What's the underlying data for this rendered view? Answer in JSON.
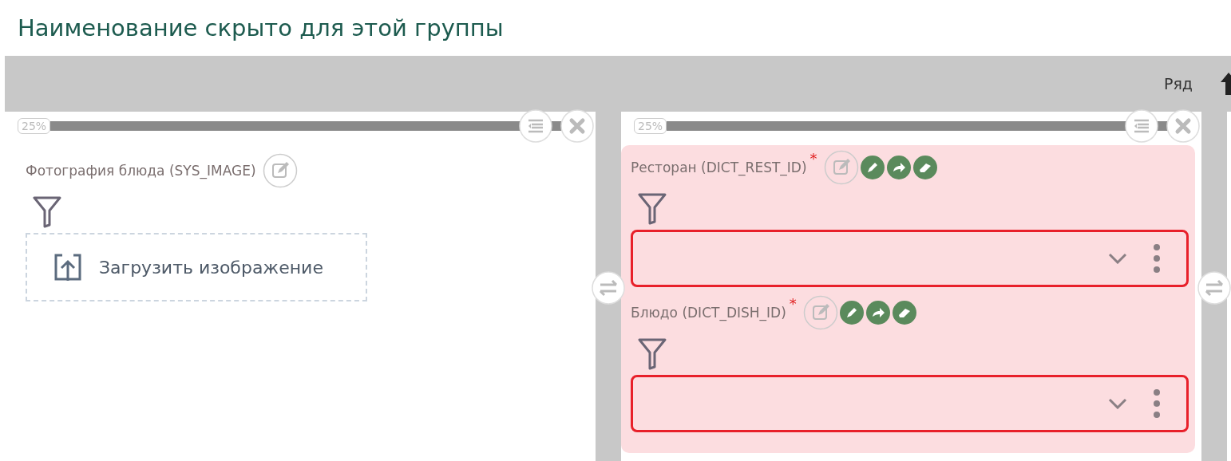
{
  "title": "Наименование скрыто для этой группы",
  "row_bar": {
    "label": "Ряд"
  },
  "columns": [
    {
      "width_label": "25%",
      "fields": [
        {
          "kind": "image",
          "label": "Фотография блюда (SYS_IMAGE)",
          "invalid": false,
          "upload_label": "Загрузить изображение"
        }
      ]
    },
    {
      "width_label": "25%",
      "fields": [
        {
          "kind": "select",
          "label": "Ресторан (DICT_REST_ID)",
          "required_mark": "*",
          "invalid": true
        },
        {
          "kind": "select",
          "label": "Блюдо (DICT_DISH_ID)",
          "required_mark": "*",
          "invalid": true
        }
      ]
    }
  ]
}
